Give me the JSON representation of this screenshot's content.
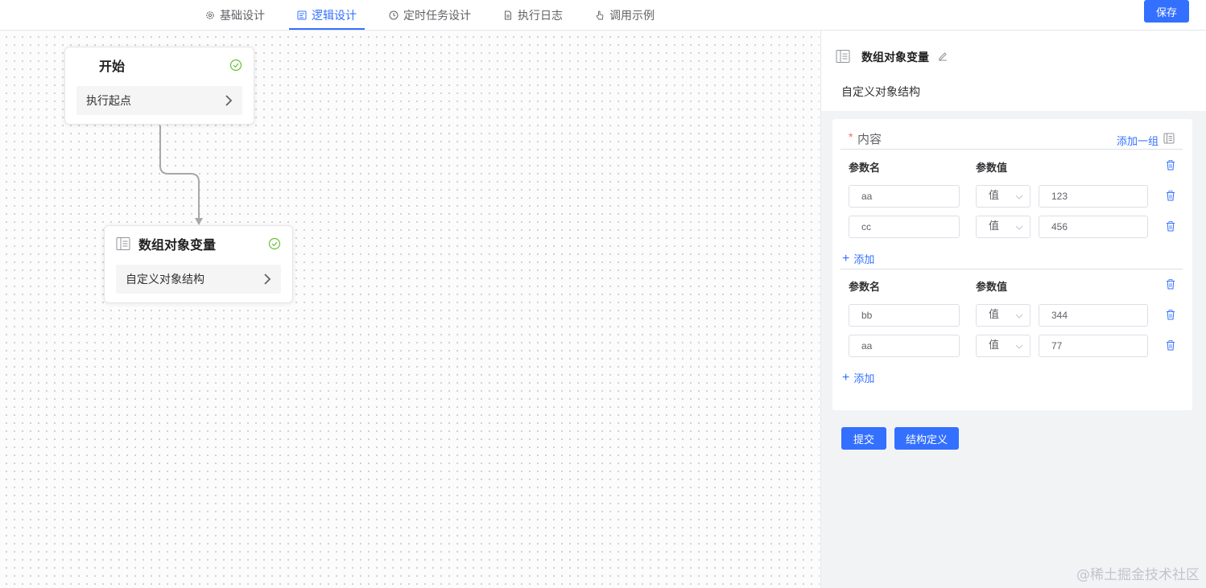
{
  "tabs": [
    {
      "label": "基础设计",
      "icon": "gear-icon",
      "active": false
    },
    {
      "label": "逻辑设计",
      "icon": "flow-icon",
      "active": true
    },
    {
      "label": "定时任务设计",
      "icon": "clock-icon",
      "active": false
    },
    {
      "label": "执行日志",
      "icon": "document-icon",
      "active": false
    },
    {
      "label": "调用示例",
      "icon": "hand-pointer-icon",
      "active": false
    }
  ],
  "toolbar": {
    "save_label": "保存"
  },
  "canvas": {
    "nodes": [
      {
        "title": "开始",
        "body": "执行起点",
        "status": "success"
      },
      {
        "title": "数组对象变量",
        "body": "自定义对象结构",
        "status": "success"
      }
    ]
  },
  "panel": {
    "title": "数组对象变量",
    "description": "自定义对象结构",
    "content_label": "内容",
    "required_mark": "*",
    "add_group_label": "添加一组",
    "groups": [
      {
        "name_header": "参数名",
        "value_header": "参数值",
        "rows": [
          {
            "name": "aa",
            "type": "值",
            "value": "123"
          },
          {
            "name": "cc",
            "type": "值",
            "value": "456"
          }
        ],
        "add_label": "添加"
      },
      {
        "name_header": "参数名",
        "value_header": "参数值",
        "rows": [
          {
            "name": "bb",
            "type": "值",
            "value": "344"
          },
          {
            "name": "aa",
            "type": "值",
            "value": "77"
          }
        ],
        "add_label": "添加"
      }
    ],
    "submit_label": "提交",
    "struct_label": "结构定义"
  },
  "watermark": "@稀土掘金技术社区",
  "colors": {
    "accent": "#3370ff",
    "success": "#67c23a",
    "required": "#f56c6c"
  }
}
